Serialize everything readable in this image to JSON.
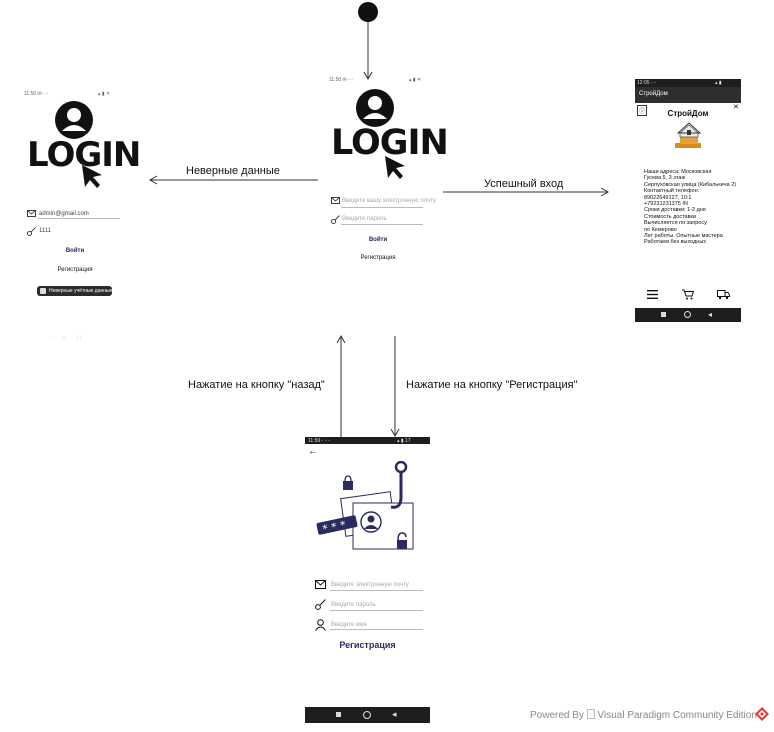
{
  "edges": {
    "wrong_data": "Неверные данные",
    "success_login": "Успешный вход",
    "back_button": "Нажатие на кнопку \"назад\"",
    "register_button": "Нажатие на кнопку \"Регистрация\""
  },
  "login_screen": {
    "logo": "LOGIN",
    "email_placeholder": "Введите вашу электронную почту",
    "password_placeholder": "Введите пароль",
    "login_label": "Войти",
    "register_label": "Регистрация"
  },
  "error_screen": {
    "logo": "LOGIN",
    "email_value": "admin@gmail.com",
    "password_value": "1111",
    "login_label": "Войти",
    "register_label": "Регистрация",
    "toast": "Неверные учётные данные"
  },
  "shop_screen": {
    "app_title": "СтройДом",
    "brand": "СтройДом",
    "info_lines": [
      "Наши адреса: Московская",
      "Гусева 5, 3 этаж",
      "Серпуховская улица (Кибальчича 2)",
      "Контактный телефон:",
      "89022649127, 10:1",
      "+79231231375 IN",
      "Сроки доставки: 1-2 дня",
      "Стоимость доставки",
      "Вычисляется по запросу",
      "по Кемерово",
      "Лет работы. Опытные мастера",
      "Работаем без выходных"
    ],
    "nav_icons": [
      "menu-icon",
      "cart-icon",
      "truck-icon"
    ]
  },
  "register_screen": {
    "email_placeholder": "Введите электронную почту",
    "password_placeholder": "Введите пароль",
    "name_placeholder": "Введите имя",
    "register_label": "Регистрация"
  },
  "footer": {
    "powered_by": "Powered By",
    "edition": "Visual Paradigm Community Edition"
  },
  "colors": {
    "navy": "#2a2a5e",
    "black": "#111111",
    "status_bar": "#1e1e1e",
    "vp_red": "#e03a3a"
  }
}
